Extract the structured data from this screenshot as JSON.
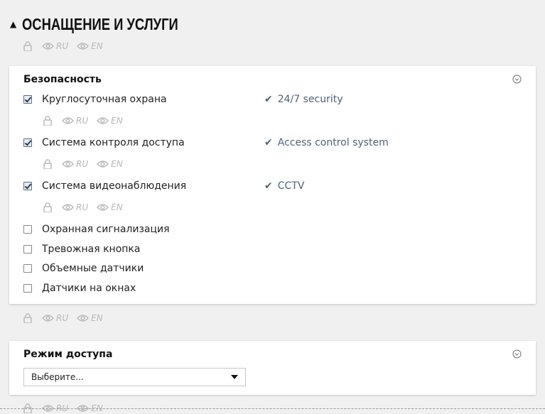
{
  "section": {
    "title": "ОСНАЩЕНИЕ И УСЛУГИ",
    "arrow": "▲"
  },
  "visibility": {
    "ru": "RU",
    "en": "EN"
  },
  "security": {
    "title": "Безопасность",
    "items": [
      {
        "label": "Круглосуточная охрана",
        "checked": true,
        "translation": "24/7 security"
      },
      {
        "label": "Система контроля доступа",
        "checked": true,
        "translation": "Access control system"
      },
      {
        "label": "Система видеонаблюдения",
        "checked": true,
        "translation": "CCTV"
      },
      {
        "label": "Охранная сигнализация",
        "checked": false
      },
      {
        "label": "Тревожная кнопка",
        "checked": false
      },
      {
        "label": "Объемные датчики",
        "checked": false
      },
      {
        "label": "Датчики на окнах",
        "checked": false
      }
    ]
  },
  "access": {
    "title": "Режим доступа",
    "select_value": "Выберите..."
  },
  "icons": {
    "lock": "lock-icon",
    "eye": "eye-icon",
    "toggle": "collapse-circle-icon",
    "check": "✔",
    "caret": "caret-down-icon"
  },
  "colors": {
    "accent": "#4f6278",
    "muted": "#b8b8b8"
  }
}
